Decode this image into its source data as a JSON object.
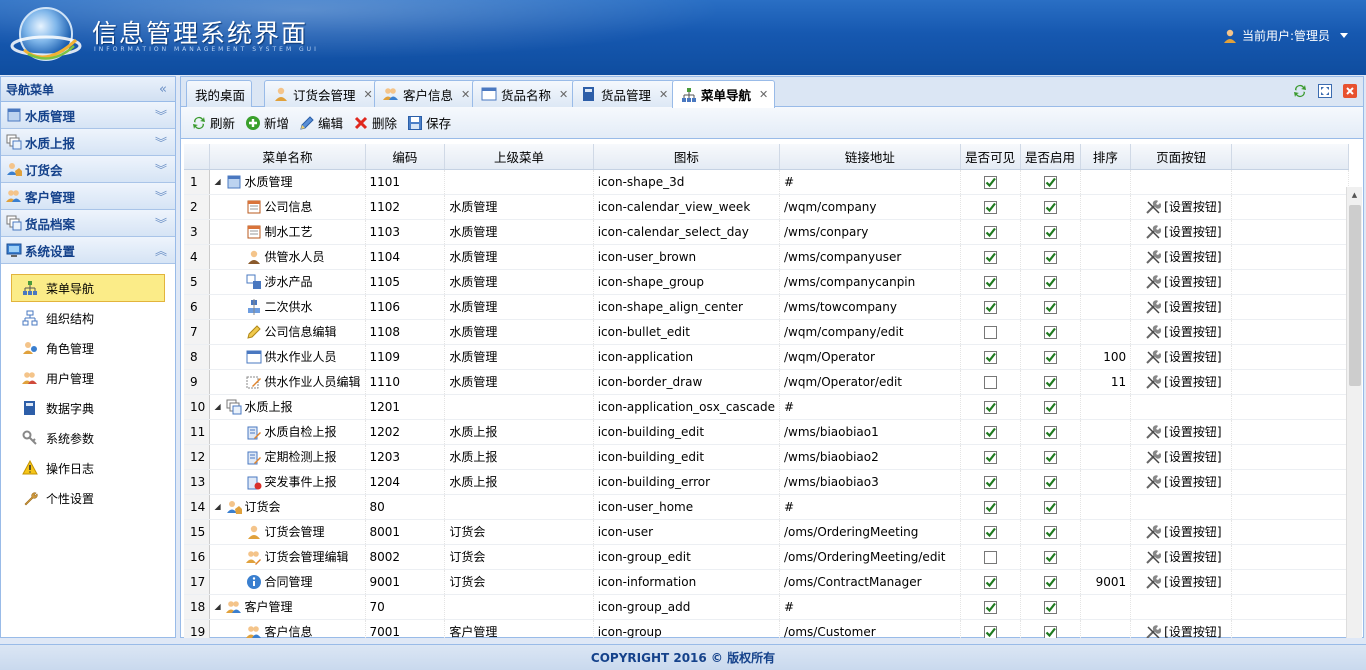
{
  "header": {
    "title": "信息管理系统界面",
    "subtitle": "INFORMATION MANAGEMENT SYSTEM GUI",
    "user_label": "当前用户:管理员"
  },
  "sidebar": {
    "title": "导航菜单",
    "groups": [
      {
        "label": "水质管理",
        "icon": "panel-icon"
      },
      {
        "label": "水质上报",
        "icon": "cascade-icon"
      },
      {
        "label": "订货会",
        "icon": "user-home-icon"
      },
      {
        "label": "客户管理",
        "icon": "group-add-icon"
      },
      {
        "label": "货品档案",
        "icon": "cascade-icon"
      },
      {
        "label": "系统设置",
        "icon": "monitor-icon"
      }
    ],
    "items": [
      {
        "label": "菜单导航",
        "icon": "sitemap-icon",
        "active": true
      },
      {
        "label": "组织结构",
        "icon": "org-icon"
      },
      {
        "label": "角色管理",
        "icon": "role-icon"
      },
      {
        "label": "用户管理",
        "icon": "users-icon"
      },
      {
        "label": "数据字典",
        "icon": "book-icon"
      },
      {
        "label": "系统参数",
        "icon": "key-icon"
      },
      {
        "label": "操作日志",
        "icon": "warning-icon"
      },
      {
        "label": "个性设置",
        "icon": "wrench-icon"
      }
    ]
  },
  "tabs": [
    {
      "label": "我的桌面",
      "closable": false
    },
    {
      "label": "订货会管理",
      "closable": true
    },
    {
      "label": "客户信息",
      "closable": true
    },
    {
      "label": "货品名称",
      "closable": true
    },
    {
      "label": "货品管理",
      "closable": true
    },
    {
      "label": "菜单导航",
      "closable": true,
      "active": true
    }
  ],
  "toolbar": {
    "refresh": "刷新",
    "add": "新增",
    "edit": "编辑",
    "delete": "删除",
    "save": "保存"
  },
  "grid": {
    "columns": [
      "菜单名称",
      "编码",
      "上级菜单",
      "图标",
      "链接地址",
      "是否可见",
      "是否启用",
      "排序",
      "页面按钮"
    ],
    "button_label": "[设置按钮]",
    "rows": [
      {
        "n": "1",
        "name": "水质管理",
        "level": 0,
        "expand": true,
        "code": "1101",
        "parent": "",
        "icon": "icon-shape_3d",
        "url": "#",
        "visible": true,
        "enabled": true,
        "sort": "",
        "btn": false
      },
      {
        "n": "2",
        "name": "公司信息",
        "level": 1,
        "code": "1102",
        "parent": "水质管理",
        "icon": "icon-calendar_view_week",
        "url": "/wqm/company",
        "visible": true,
        "enabled": true,
        "sort": "",
        "btn": true
      },
      {
        "n": "3",
        "name": "制水工艺",
        "level": 1,
        "code": "1103",
        "parent": "水质管理",
        "icon": "icon-calendar_select_day",
        "url": "/wms/conpary",
        "visible": true,
        "enabled": true,
        "sort": "",
        "btn": true
      },
      {
        "n": "4",
        "name": "供管水人员",
        "level": 1,
        "code": "1104",
        "parent": "水质管理",
        "icon": "icon-user_brown",
        "url": "/wms/companyuser",
        "visible": true,
        "enabled": true,
        "sort": "",
        "btn": true
      },
      {
        "n": "5",
        "name": "涉水产品",
        "level": 1,
        "code": "1105",
        "parent": "水质管理",
        "icon": "icon-shape_group",
        "url": "/wms/companycanpin",
        "visible": true,
        "enabled": true,
        "sort": "",
        "btn": true
      },
      {
        "n": "6",
        "name": "二次供水",
        "level": 1,
        "code": "1106",
        "parent": "水质管理",
        "icon": "icon-shape_align_center",
        "url": "/wms/towcompany",
        "visible": true,
        "enabled": true,
        "sort": "",
        "btn": true
      },
      {
        "n": "7",
        "name": "公司信息编辑",
        "level": 1,
        "code": "1108",
        "parent": "水质管理",
        "icon": "icon-bullet_edit",
        "url": "/wqm/company/edit",
        "visible": false,
        "enabled": true,
        "sort": "",
        "btn": true
      },
      {
        "n": "8",
        "name": "供水作业人员",
        "level": 1,
        "code": "1109",
        "parent": "水质管理",
        "icon": "icon-application",
        "url": "/wqm/Operator",
        "visible": true,
        "enabled": true,
        "sort": "100",
        "btn": true
      },
      {
        "n": "9",
        "name": "供水作业人员编辑",
        "level": 1,
        "code": "1110",
        "parent": "水质管理",
        "icon": "icon-border_draw",
        "url": "/wqm/Operator/edit",
        "visible": false,
        "enabled": true,
        "sort": "11",
        "btn": true
      },
      {
        "n": "10",
        "name": "水质上报",
        "level": 0,
        "expand": true,
        "code": "1201",
        "parent": "",
        "icon": "icon-application_osx_cascade",
        "url": "#",
        "visible": true,
        "enabled": true,
        "sort": "",
        "btn": false
      },
      {
        "n": "11",
        "name": "水质自检上报",
        "level": 1,
        "code": "1202",
        "parent": "水质上报",
        "icon": "icon-building_edit",
        "url": "/wms/biaobiao1",
        "visible": true,
        "enabled": true,
        "sort": "",
        "btn": true
      },
      {
        "n": "12",
        "name": "定期检测上报",
        "level": 1,
        "code": "1203",
        "parent": "水质上报",
        "icon": "icon-building_edit",
        "url": "/wms/biaobiao2",
        "visible": true,
        "enabled": true,
        "sort": "",
        "btn": true
      },
      {
        "n": "13",
        "name": "突发事件上报",
        "level": 1,
        "code": "1204",
        "parent": "水质上报",
        "icon": "icon-building_error",
        "url": "/wms/biaobiao3",
        "visible": true,
        "enabled": true,
        "sort": "",
        "btn": true
      },
      {
        "n": "14",
        "name": "订货会",
        "level": 0,
        "expand": true,
        "code": "80",
        "parent": "",
        "icon": "icon-user_home",
        "url": "#",
        "visible": true,
        "enabled": true,
        "sort": "",
        "btn": false
      },
      {
        "n": "15",
        "name": "订货会管理",
        "level": 1,
        "code": "8001",
        "parent": "订货会",
        "icon": "icon-user",
        "url": "/oms/OrderingMeeting",
        "visible": true,
        "enabled": true,
        "sort": "",
        "btn": true
      },
      {
        "n": "16",
        "name": "订货会管理编辑",
        "level": 1,
        "code": "8002",
        "parent": "订货会",
        "icon": "icon-group_edit",
        "url": "/oms/OrderingMeeting/edit",
        "visible": false,
        "enabled": true,
        "sort": "",
        "btn": true
      },
      {
        "n": "17",
        "name": "合同管理",
        "level": 1,
        "code": "9001",
        "parent": "订货会",
        "icon": "icon-information",
        "url": "/oms/ContractManager",
        "visible": true,
        "enabled": true,
        "sort": "9001",
        "btn": true
      },
      {
        "n": "18",
        "name": "客户管理",
        "level": 0,
        "expand": true,
        "code": "70",
        "parent": "",
        "icon": "icon-group_add",
        "url": "#",
        "visible": true,
        "enabled": true,
        "sort": "",
        "btn": false
      },
      {
        "n": "19",
        "name": "客户信息",
        "level": 1,
        "code": "7001",
        "parent": "客户管理",
        "icon": "icon-group",
        "url": "/oms/Customer",
        "visible": true,
        "enabled": true,
        "sort": "",
        "btn": true
      }
    ]
  },
  "footer": {
    "text": "COPYRIGHT 2016 © 版权所有"
  }
}
